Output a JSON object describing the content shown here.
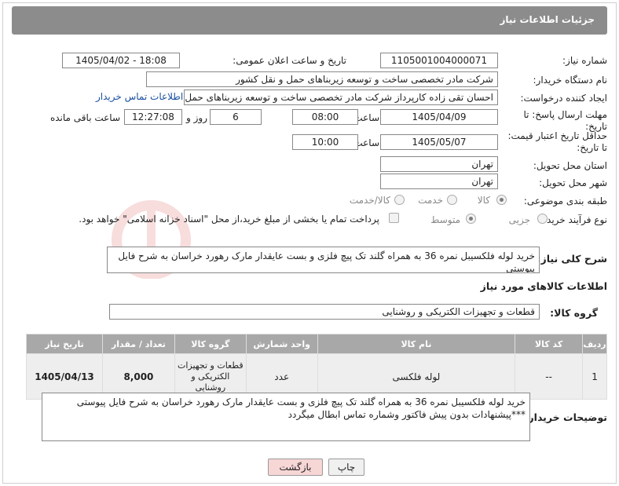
{
  "header": {
    "title": "جزئیات اطلاعات نیاز"
  },
  "labels": {
    "need_number": "شماره نیاز:",
    "announce_datetime": "تاریخ و ساعت اعلان عمومی:",
    "buyer_org": "نام دستگاه خریدار:",
    "requester": "ایجاد کننده درخواست:",
    "deadline": "مهلت ارسال پاسخ: تا تاریخ:",
    "min_price_validity": "حداقل تاریخ اعتبار قیمت: تا تاریخ:",
    "time": "ساعت",
    "time2": "ساعت",
    "day_and": "روز و",
    "remaining": "ساعت باقی مانده",
    "delivery_province": "استان محل تحویل:",
    "delivery_city": "شهر محل تحویل:",
    "category": "طبقه بندی موضوعی:",
    "process_type": "نوع فرآیند خرید :",
    "general_desc": "شرح کلی نیاز:",
    "goods_info": "اطلاعات کالاهای مورد نیاز",
    "goods_group": "گروه کالا:",
    "buyer_notes": "توضیحات خریدار:"
  },
  "values": {
    "need_number": "1105001004000071",
    "announce_datetime": "1405/04/02 - 18:08",
    "buyer_org": "شرکت مادر تخصصی ساخت و توسعه زیربناهای حمل و نقل کشور",
    "requester": "احسان تقی زاده کارپرداز شرکت مادر تخصصی ساخت و توسعه زیربناهای حمل و",
    "contact_link": "اطلاعات تماس خریدار",
    "deadline_date": "1405/04/09",
    "deadline_time": "08:00",
    "days": "6",
    "remaining_time": "12:27:08",
    "validity_date": "1405/05/07",
    "validity_time": "10:00",
    "province": "تهران",
    "city": "تهران",
    "general_desc": "خرید لوله فلکسیبل نمره 36 به همراه گلند تک پیچ فلزی و بست عایقدار مارک رهورد خراسان به شرح فایل پیوستی",
    "goods_group": "قطعات و تجهیزات الکتریکی و روشنایی",
    "buyer_notes_line1": "خرید لوله فلکسیبل نمره 36 به همراه گلند تک پیچ فلزی و بست عایقدار مارک رهورد خراسان به شرح فایل پیوستی",
    "buyer_notes_line2": "***پیشنهادات بدون پیش فاکتور وشماره تماس ابطال میگردد"
  },
  "category_options": [
    {
      "label": "کالا",
      "selected": true
    },
    {
      "label": "خدمت",
      "selected": false
    },
    {
      "label": "کالا/خدمت",
      "selected": false
    }
  ],
  "process_options": [
    {
      "label": "جزیی",
      "selected": false
    },
    {
      "label": "متوسط",
      "selected": true
    }
  ],
  "payment_note": "پرداخت تمام یا بخشی از مبلغ خرید،از محل \"اسناد خزانه اسلامی\" خواهد بود.",
  "table": {
    "headers": [
      "ردیف",
      "کد کالا",
      "نام کالا",
      "واحد شمارش",
      "گروه کالا",
      "تعداد / مقدار",
      "تاریخ نیاز"
    ],
    "rows": [
      [
        "1",
        "--",
        "لوله فلکسی",
        "عدد",
        "قطعات و تجهیزات الکتریکی و روشنایی",
        "8,000",
        "1405/04/13"
      ]
    ]
  },
  "buttons": {
    "print": "چاپ",
    "back": "بازگشت"
  },
  "colors": {
    "header_bg": "#8c8c8c",
    "table_header_bg": "#a8a8a8",
    "back_button_bg": "#f7d6d6",
    "link": "#1a4fa0"
  }
}
